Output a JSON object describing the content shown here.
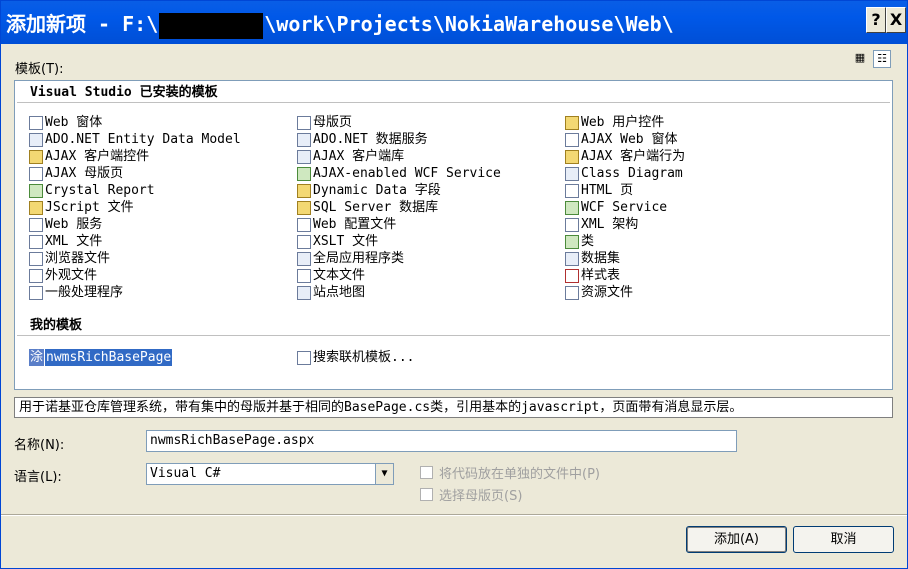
{
  "window": {
    "title_prefix": "添加新项 - F:\\",
    "title_suffix": "\\work\\Projects\\NokiaWarehouse\\Web\\",
    "help_button": "?",
    "close_button": "X"
  },
  "templates_label": "模板(T):",
  "installed_header": "Visual Studio 已安装的模板",
  "installed": {
    "col1": [
      "Web 窗体",
      "ADO.NET Entity Data Model",
      "AJAX 客户端控件",
      "AJAX 母版页",
      "Crystal Report",
      "JScript 文件",
      "Web 服务",
      "XML 文件",
      "浏览器文件",
      "外观文件",
      "一般处理程序"
    ],
    "col2": [
      "母版页",
      "ADO.NET 数据服务",
      "AJAX 客户端库",
      "AJAX-enabled WCF Service",
      "Dynamic Data 字段",
      "SQL Server 数据库",
      "Web 配置文件",
      "XSLT 文件",
      "全局应用程序类",
      "文本文件",
      "站点地图"
    ],
    "col3": [
      "Web 用户控件",
      "AJAX Web 窗体",
      "AJAX 客户端行为",
      "Class Diagram",
      "HTML 页",
      "WCF Service",
      "XML 架构",
      "类",
      "数据集",
      "样式表",
      "资源文件"
    ]
  },
  "my_templates_header": "我的模板",
  "my_templates": {
    "selected_icon_text": "涂",
    "selected_item": "nwmsRichBasePage",
    "search_item": "搜索联机模板..."
  },
  "description": "用于诺基亚仓库管理系统，带有集中的母版并基于相同的BasePage.cs类，引用基本的javascript，页面带有消息显示层。",
  "name_label": "名称(N):",
  "name_value": "nwmsRichBasePage.aspx",
  "language_label": "语言(L):",
  "language_value": "Visual C#",
  "checkbox_separate_code": "将代码放在单独的文件中(P)",
  "checkbox_master_page": "选择母版页(S)",
  "add_button": "添加(A)",
  "cancel_button": "取消",
  "colors": {
    "title_bar": "#0058e8",
    "selection": "#316ac5",
    "dialog_bg": "#ece9d8"
  }
}
